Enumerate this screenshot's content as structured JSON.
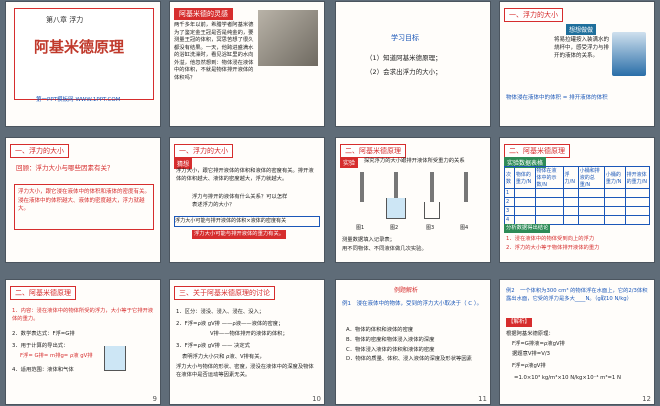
{
  "slides": [
    {
      "num": "",
      "chapter": "第八章 浮力",
      "title": "阿基米德原理",
      "footer": "第一PPT模板网-WWW.1PPT.COM"
    },
    {
      "num": "",
      "header": "阿基米德的灵感",
      "text": "两千多年以前，希腊学者阿基米德为了鉴定金王冠是否是纯金的，要测量王冠的体积，冥思苦想了很久都没有结果。一天，他跨进盛满水的浴缸洗澡时，看见浴缸里的水向外溢，他忽然想到：物体浸在液体中的体积，不就是物体排开液体的体积吗？"
    },
    {
      "num": "",
      "title": "学习目标",
      "goals": [
        "（1）知道阿基米德原理；",
        "（2）会求出浮力的大小；"
      ]
    },
    {
      "num": "",
      "header": "一、浮力的大小",
      "tag": "想想做做",
      "text": "将易拉罐按入装满水的烧杯中，感受浮力与排开的液体的关系。",
      "caption": "物体浸在液体中的体积 = 排开液体的体积"
    },
    {
      "num": "",
      "header": "一、浮力的大小",
      "q": "回顾：浮力大小与哪些因素有关？",
      "a": "浮力大小，跟它浸在液体中的体积和液体的密度有关。浸在液体中的体积越大、液体的密度越大，浮力就越大。"
    },
    {
      "num": "",
      "header": "一、浮力的大小",
      "tag": "猜想",
      "text": "浮力大小，跟它排开液体的体积和液体的密度有关。排开液体的体积越大、液体的密度越大，浮力就越大。",
      "q": "浮力与排开的液体有什么关系？可以怎样表述浮力的大小？",
      "line1": "浮力大小可能与排开液体的体积×液体的密度有关",
      "line2": "浮力大小可能与排开液体的重力有关。"
    },
    {
      "num": "",
      "header": "二、阿基米德原理",
      "tag": "实验",
      "text": "探究浮力的大小跟排开液体所受重力的关系",
      "figs": [
        "图1",
        "图2",
        "图3",
        "图4"
      ],
      "foot1": "测量数据填入记录表；",
      "foot2": "用不同物体、不同液体做几次实验。"
    },
    {
      "num": "",
      "header": "二、阿基米德原理",
      "tag": "实验数据表格",
      "cols": [
        "次数",
        "物体的重力/N",
        "物体在液体中的示数/N",
        "浮力/N",
        "小桶和排液的总重/N",
        "小桶的重力/N",
        "排开液体的重力/N"
      ],
      "rows": [
        "1",
        "2",
        "3",
        "4"
      ],
      "analysis": "分析数据得出结论",
      "c1": "1．浸在液体中的物体受到向上的浮力",
      "c2": "2．浮力的大小等于物体排开液体的重力"
    },
    {
      "num": "9",
      "header": "二、阿基米德原理",
      "l1": "1．内容：浸在液体中的物体所受的浮力，大小等于它排开液体的重力。",
      "l2": "2．数学表达式：F浮=G排",
      "l3": "3．用于计算的导出式：",
      "l4": "F浮= G排= m排g= ρ液 gV排",
      "l5": "4．适用范围：液体和气体"
    },
    {
      "num": "10",
      "header": "三、关于阿基米德原理的讨论",
      "l1": "1．区分：浸没、浸入、浸在、没入；",
      "l2": "2．F浮=ρ液 gV排 ——ρ液——液体的密度；",
      "l3": "V排——物体排开的液体的体积；",
      "l4": "3．F浮=ρ液 gV排 —— 决定式",
      "l5": "表明浮力大小只和 ρ液、V排有关，",
      "l6": "浮力大小与物体的形状、密度，浸没在液体中的深度及物体在液体中是否运动等因素无关。"
    },
    {
      "num": "11",
      "title": "例题解析",
      "q": "例1　浸在液体中的物体，受到的浮力大小取决于（ C ）。",
      "opts": [
        "A．物体的体积和液体的密度",
        "B．物体的密度和物体浸入液体的深度",
        "C．物体浸入液体的体积和液体的密度",
        "D．物体的质量、体积、浸入液体的深度及形状等因素"
      ]
    },
    {
      "num": "12",
      "q": "例2　一个体积为300 cm³ 的物体浮在水面上，它的2/3体积露出水面，它受的浮力是多大____N。（g取10 N/kg）",
      "tag": "【解析】",
      "s1": "根据阿基米德原理：",
      "s2": "F浮=G排液=ρ液gV排",
      "s3": "据题意V排=V/3",
      "s4": "F浮=ρ液gV排",
      "s5": "=1.0×10³ kg/m³×10 N/kg×10⁻⁴ m³=1 N"
    }
  ],
  "colors": {
    "accent": "#d62d2d",
    "blue": "#1b57b8",
    "bg": "#5f6c78"
  }
}
